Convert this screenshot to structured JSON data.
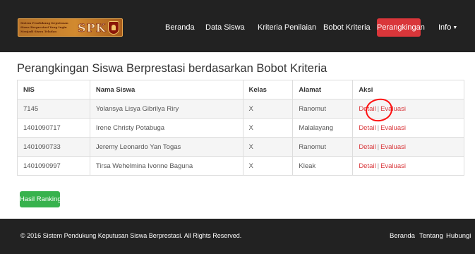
{
  "navbar": {
    "logo": {
      "caption": "Sistem Pendukung Keputusan Siswa Berprestasi Yang Ingin Menjadi Siswa Teladan",
      "acronym": "SPK"
    },
    "items": [
      {
        "label": "Beranda",
        "active": false
      },
      {
        "label": "Data Siswa",
        "active": false
      },
      {
        "label": "Kriteria Penilaian",
        "active": false
      },
      {
        "label": "Bobot Kriteria",
        "active": false
      },
      {
        "label": "Perangkingan",
        "active": true
      },
      {
        "label": "Info",
        "active": false,
        "dropdown": true
      }
    ]
  },
  "page_title": "Perangkingan Siswa Berprestasi berdasarkan Bobot Kriteria",
  "table": {
    "headers": [
      "NIS",
      "Nama Siswa",
      "Kelas",
      "Alamat",
      "Aksi"
    ],
    "rows": [
      {
        "nis": "7145",
        "nama": "Yolansya Lisya Gibrilya Riry",
        "kelas": "X",
        "alamat": "Ranomut",
        "detail": "Detail",
        "evaluasi": "Evaluasi"
      },
      {
        "nis": "1401090717",
        "nama": "Irene Christy Potabuga",
        "kelas": "X",
        "alamat": "Malalayang",
        "detail": "Detail",
        "evaluasi": "Evaluasi"
      },
      {
        "nis": "1401090733",
        "nama": "Jeremy Leonardo Yan Togas",
        "kelas": "X",
        "alamat": "Ranomut",
        "detail": "Detail",
        "evaluasi": "Evaluasi"
      },
      {
        "nis": "1401090997",
        "nama": "Tirsa Wehelmina Ivonne Baguna",
        "kelas": "X",
        "alamat": "Kleak",
        "detail": "Detail",
        "evaluasi": "Evaluasi"
      }
    ]
  },
  "ranking_button": "Hasil Ranking",
  "footer": {
    "copyright": "© 2016 Sistem Pendukung Keputusan Siswa Berprestasi. All Rights Reserved.",
    "links": [
      "Beranda",
      "Tentang",
      "Hubungi"
    ]
  },
  "colors": {
    "navbar_bg": "#222222",
    "accent": "#d9363a",
    "button_green": "#37b24d",
    "annotation_red": "#ff1010"
  }
}
